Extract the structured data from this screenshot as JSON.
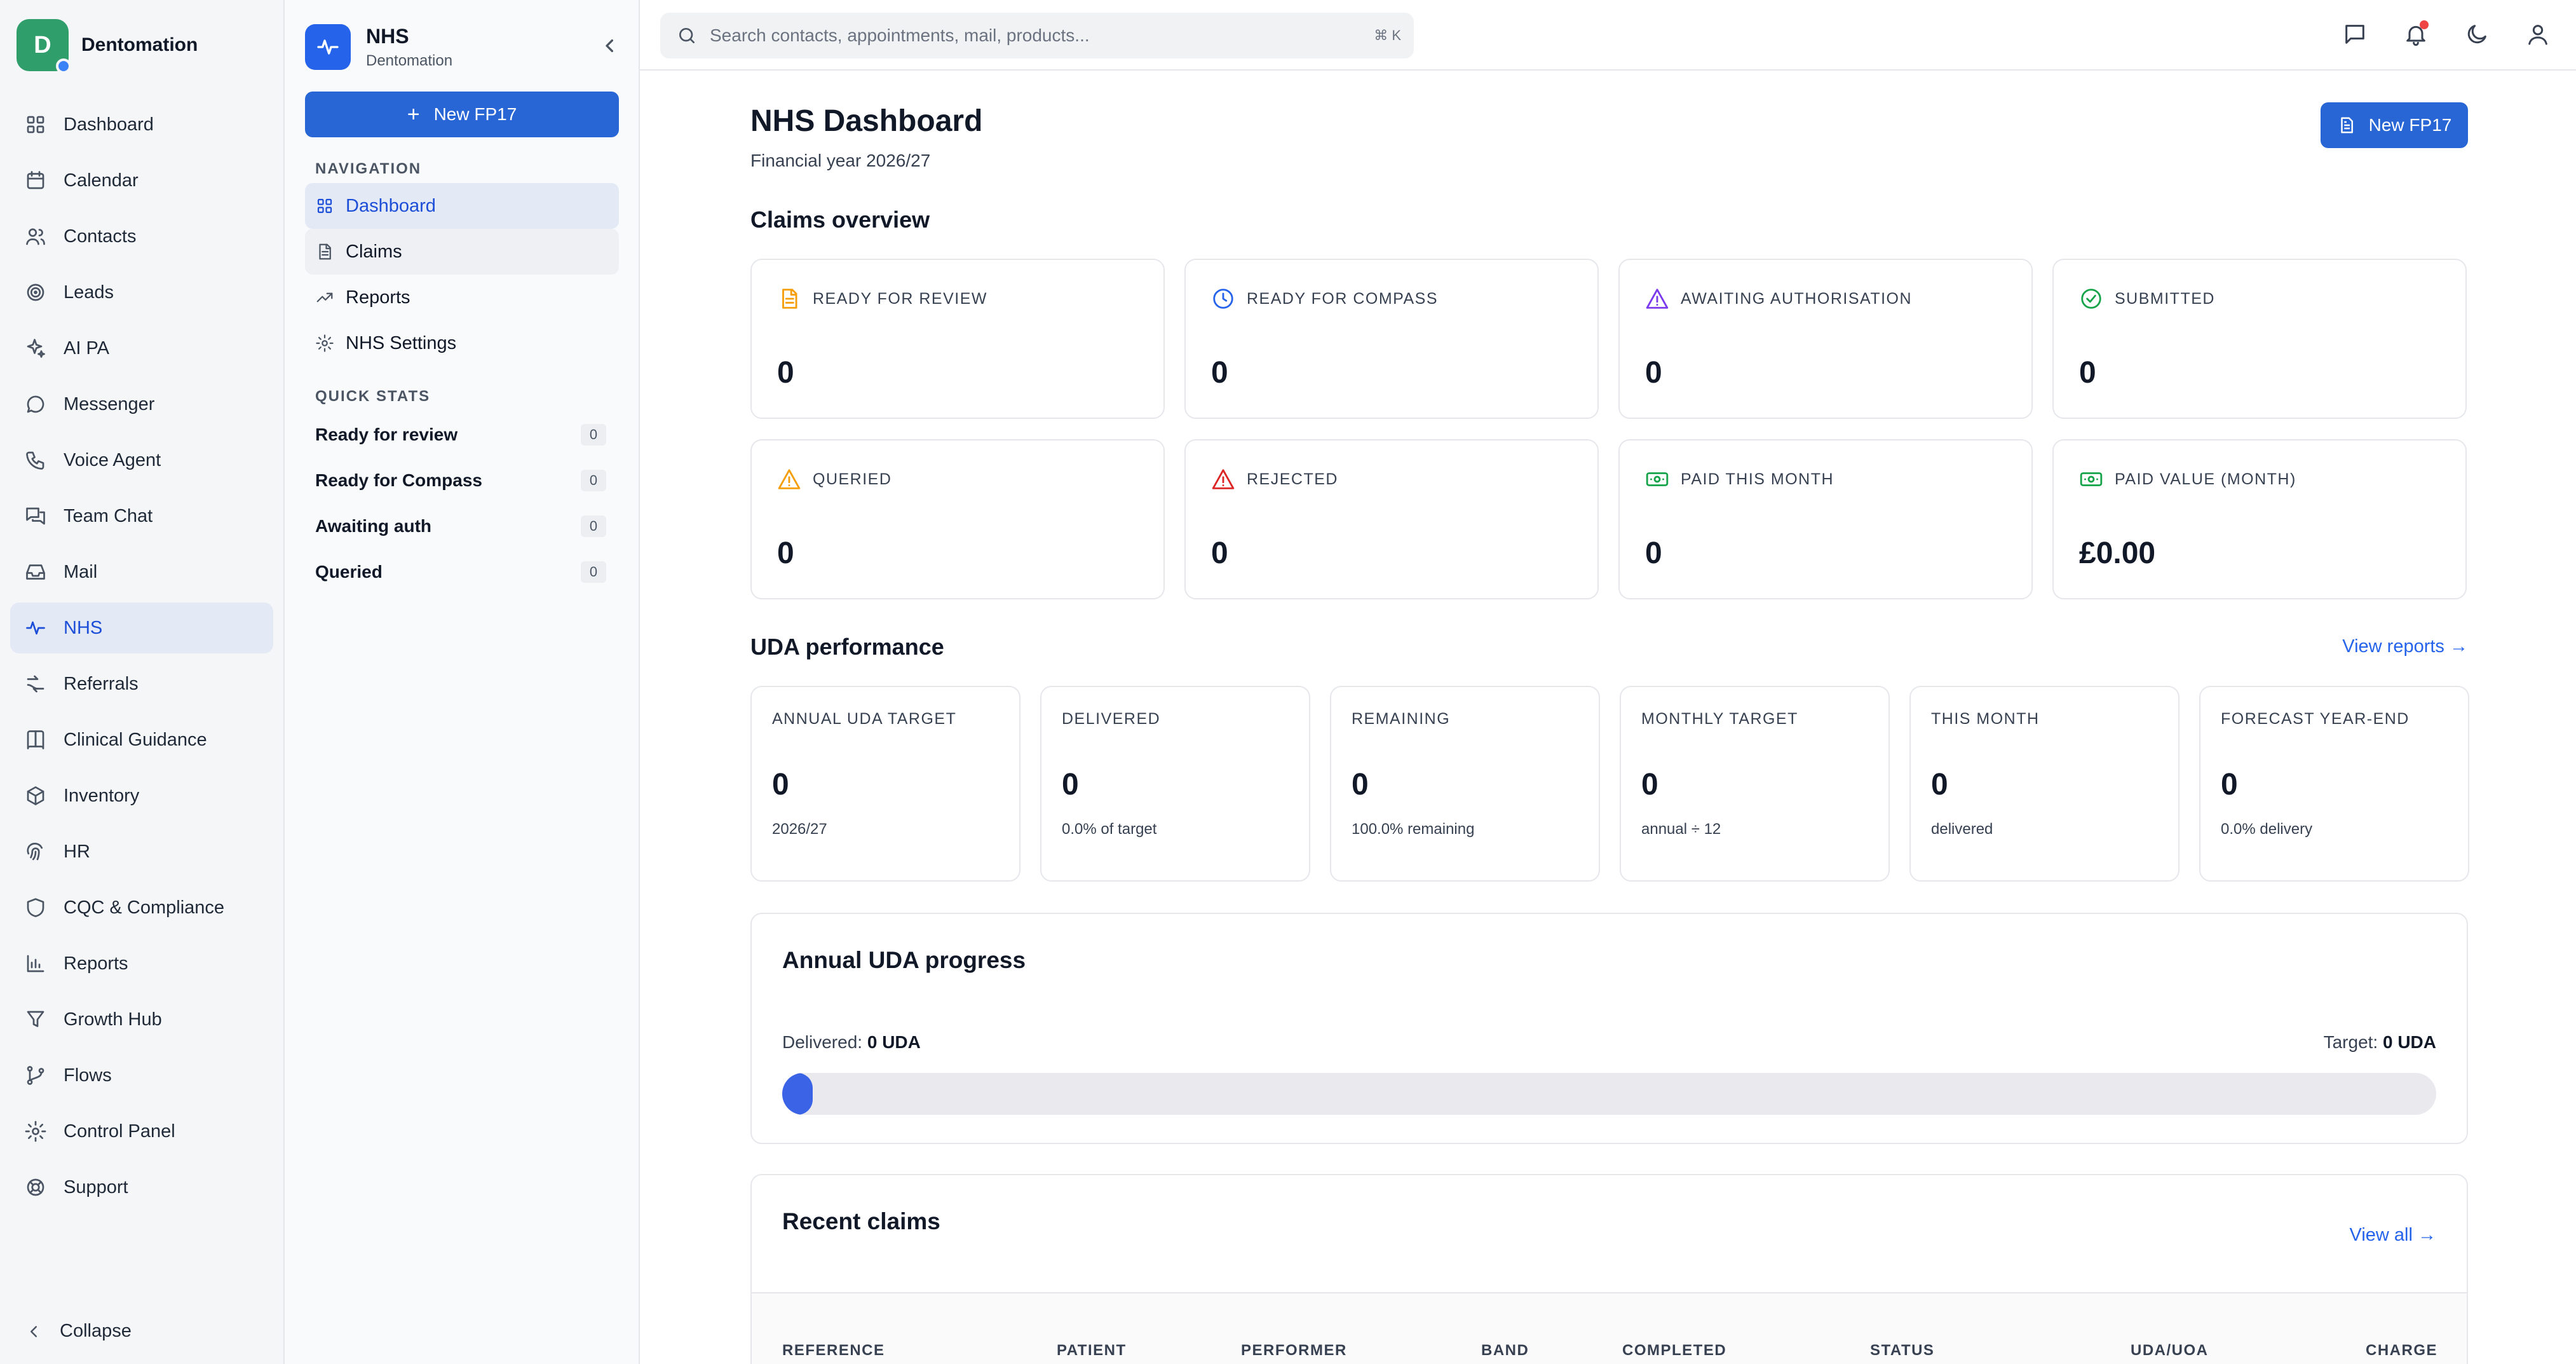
{
  "app": {
    "brand_initial": "D",
    "brand_name": "Dentomation"
  },
  "app_nav": [
    {
      "label": "Dashboard",
      "icon": "grid-icon"
    },
    {
      "label": "Calendar",
      "icon": "calendar-icon"
    },
    {
      "label": "Contacts",
      "icon": "users-icon"
    },
    {
      "label": "Leads",
      "icon": "target-icon"
    },
    {
      "label": "AI PA",
      "icon": "sparkles-icon"
    },
    {
      "label": "Messenger",
      "icon": "chat-bubble-icon"
    },
    {
      "label": "Voice Agent",
      "icon": "phone-icon"
    },
    {
      "label": "Team Chat",
      "icon": "messages-icon"
    },
    {
      "label": "Mail",
      "icon": "inbox-icon"
    },
    {
      "label": "NHS",
      "icon": "activity-icon"
    },
    {
      "label": "Referrals",
      "icon": "referral-icon"
    },
    {
      "label": "Clinical Guidance",
      "icon": "book-icon"
    },
    {
      "label": "Inventory",
      "icon": "package-icon"
    },
    {
      "label": "HR",
      "icon": "fingerprint-icon"
    },
    {
      "label": "CQC & Compliance",
      "icon": "shield-icon"
    },
    {
      "label": "Reports",
      "icon": "bar-chart-icon"
    },
    {
      "label": "Growth Hub",
      "icon": "funnel-icon"
    },
    {
      "label": "Flows",
      "icon": "branch-icon"
    },
    {
      "label": "Control Panel",
      "icon": "gear-icon"
    },
    {
      "label": "Support",
      "icon": "lifebuoy-icon"
    }
  ],
  "app_nav_active": "NHS",
  "collapse_label": "Collapse",
  "module": {
    "title": "NHS",
    "subtitle": "Dentomation",
    "new_button": "New FP17",
    "nav_section_label": "NAVIGATION",
    "nav": [
      {
        "label": "Dashboard",
        "icon": "grid-icon"
      },
      {
        "label": "Claims",
        "icon": "file-text-icon"
      },
      {
        "label": "Reports",
        "icon": "trending-up-icon"
      },
      {
        "label": "NHS Settings",
        "icon": "gear-icon"
      }
    ],
    "quick_stats_label": "QUICK STATS",
    "quick_stats": [
      {
        "label": "Ready for review",
        "count": "0"
      },
      {
        "label": "Ready for Compass",
        "count": "0"
      },
      {
        "label": "Awaiting auth",
        "count": "0"
      },
      {
        "label": "Queried",
        "count": "0"
      }
    ]
  },
  "topbar": {
    "search_placeholder": "Search contacts, appointments, mail, products...",
    "search_shortcut": "⌘ K"
  },
  "page": {
    "title": "NHS Dashboard",
    "subtitle": "Financial year 2026/27",
    "new_button": "New FP17"
  },
  "claims_overview": {
    "title": "Claims overview",
    "cards": [
      {
        "label": "READY FOR REVIEW",
        "value": "0",
        "icon": "file-text-icon",
        "color": "#f59e0b"
      },
      {
        "label": "READY FOR COMPASS",
        "value": "0",
        "icon": "clock-icon",
        "color": "#2563eb"
      },
      {
        "label": "AWAITING AUTHORISATION",
        "value": "0",
        "icon": "warning-triangle-icon",
        "color": "#7c3aed"
      },
      {
        "label": "SUBMITTED",
        "value": "0",
        "icon": "check-circle-icon",
        "color": "#16a34a"
      },
      {
        "label": "QUERIED",
        "value": "0",
        "icon": "warning-triangle-icon",
        "color": "#f59e0b"
      },
      {
        "label": "REJECTED",
        "value": "0",
        "icon": "warning-triangle-icon",
        "color": "#dc2626"
      },
      {
        "label": "PAID THIS MONTH",
        "value": "0",
        "icon": "banknote-icon",
        "color": "#16a34a"
      },
      {
        "label": "PAID VALUE (MONTH)",
        "value": "£0.00",
        "icon": "banknote-icon",
        "color": "#16a34a"
      }
    ]
  },
  "uda_performance": {
    "title": "UDA performance",
    "view_link": "View reports →",
    "cards": [
      {
        "label": "ANNUAL UDA TARGET",
        "value": "0",
        "sub": "2026/27"
      },
      {
        "label": "DELIVERED",
        "value": "0",
        "sub": "0.0% of target"
      },
      {
        "label": "REMAINING",
        "value": "0",
        "sub": "100.0% remaining"
      },
      {
        "label": "MONTHLY TARGET",
        "value": "0",
        "sub": "annual ÷ 12"
      },
      {
        "label": "THIS MONTH",
        "value": "0",
        "sub": "delivered"
      },
      {
        "label": "FORECAST YEAR-END",
        "value": "0",
        "sub": "0.0% delivery"
      }
    ]
  },
  "annual_progress": {
    "title": "Annual UDA progress",
    "delivered_label": "Delivered:",
    "delivered_value": "0 UDA",
    "target_label": "Target:",
    "target_value": "0 UDA",
    "progress_fraction": 0,
    "bar_color": "#3b63e6"
  },
  "recent_claims": {
    "title": "Recent claims",
    "view_link": "View all →",
    "columns": [
      "REFERENCE",
      "PATIENT",
      "PERFORMER",
      "BAND",
      "COMPLETED",
      "STATUS",
      "UDA/UOA",
      "CHARGE"
    ]
  }
}
